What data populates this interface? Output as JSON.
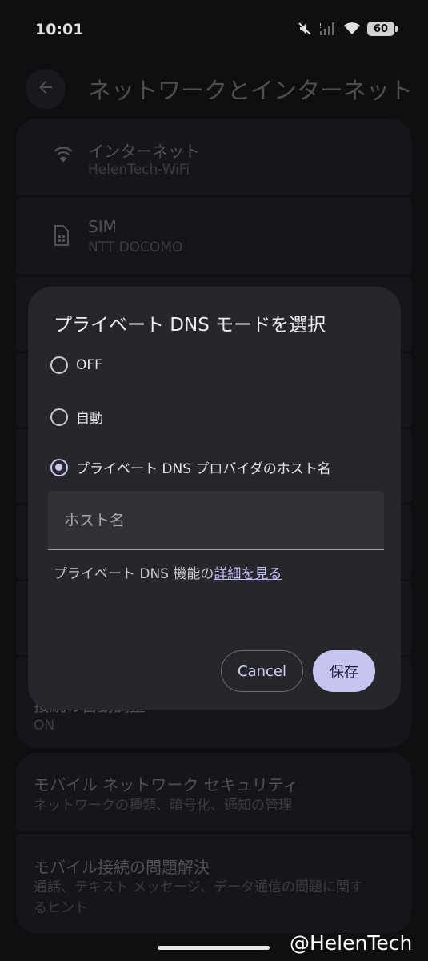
{
  "status_bar": {
    "time": "10:01",
    "battery": "60",
    "icons": [
      "mute-icon",
      "signal-icon",
      "wifi-icon",
      "battery-icon"
    ]
  },
  "header": {
    "title": "ネットワークとインターネット",
    "back_icon": "arrow-left-icon"
  },
  "list": [
    {
      "title": "インターネット",
      "subtitle": "HelenTech-WiFi",
      "icon": "wifi-icon"
    },
    {
      "title": "SIM",
      "subtitle": "NTT DOCOMO",
      "icon": "sim-icon"
    }
  ],
  "partial_item": {
    "title": "接続の自動調整",
    "subtitle": "ON"
  },
  "bottom_items": [
    {
      "title": "モバイル ネットワーク セキュリティ",
      "subtitle": "ネットワークの種類、暗号化、通知の管理"
    },
    {
      "title": "モバイル接続の問題解決",
      "subtitle": "通話、テキスト メッセージ、データ通信の問題に関するヒント"
    }
  ],
  "dialog": {
    "title": "プライベート DNS モードを選択",
    "options": [
      {
        "label": "OFF",
        "selected": false
      },
      {
        "label": "自動",
        "selected": false
      },
      {
        "label": "プライベート DNS プロバイダのホスト名",
        "selected": true
      }
    ],
    "host_placeholder": "ホスト名",
    "host_value": "",
    "help_prefix": "プライベート DNS 機能の",
    "help_link": "詳細を見る",
    "cancel_label": "Cancel",
    "save_label": "保存"
  },
  "watermark": "@HelenTech",
  "colors": {
    "accent": "#c6c4f0",
    "dialog_bg": "#26262c",
    "background": "#121214"
  }
}
